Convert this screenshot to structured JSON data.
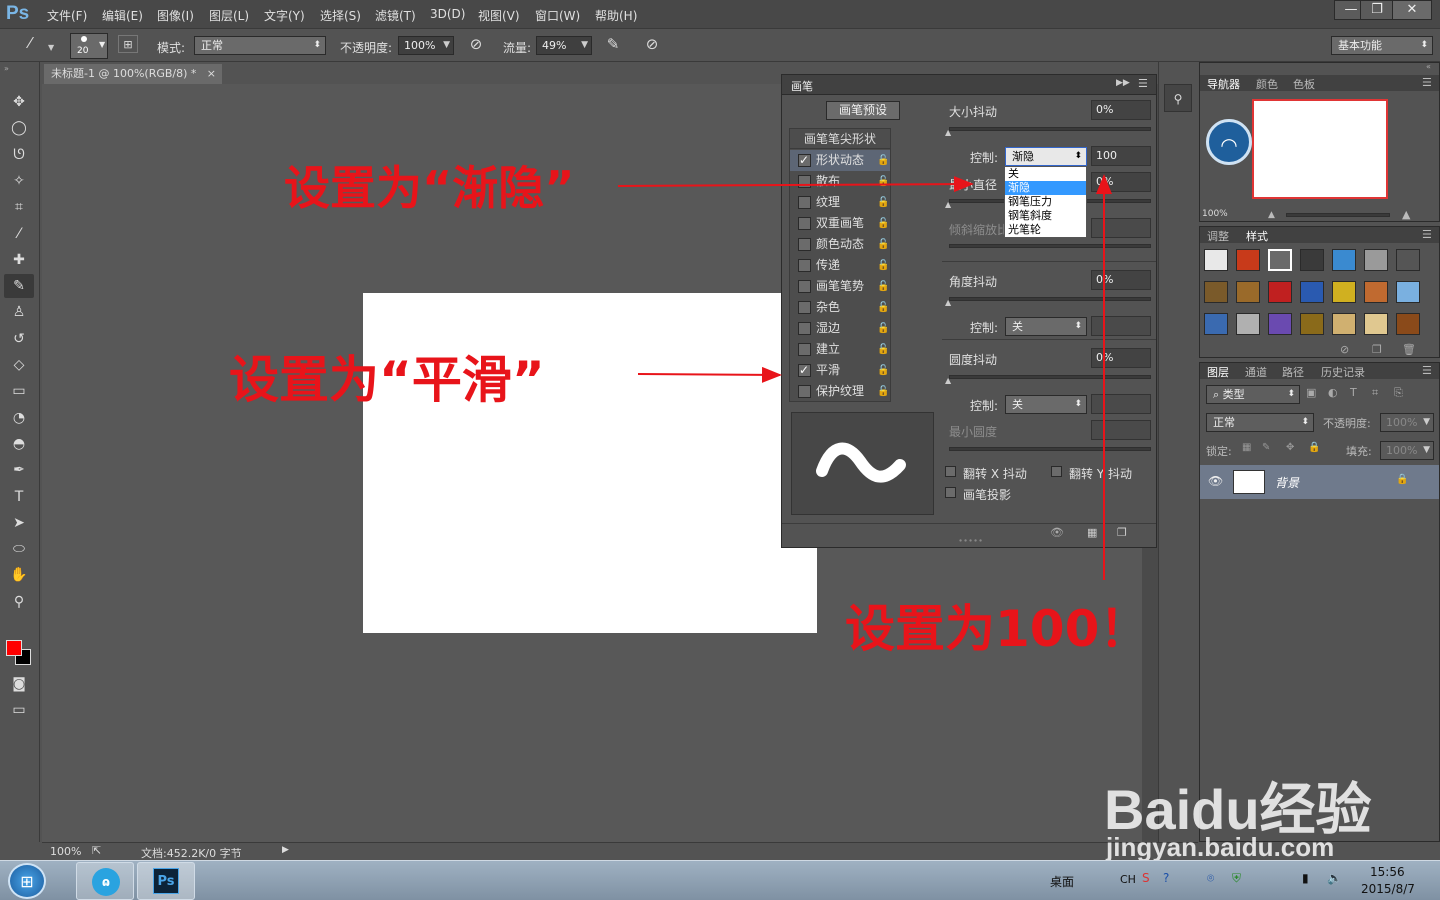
{
  "app": {
    "logo": "Ps"
  },
  "menu": [
    "文件(F)",
    "编辑(E)",
    "图像(I)",
    "图层(L)",
    "文字(Y)",
    "选择(S)",
    "滤镜(T)",
    "3D(D)",
    "视图(V)",
    "窗口(W)",
    "帮助(H)"
  ],
  "window_buttons": [
    "—",
    "❐",
    "✕"
  ],
  "options": {
    "brush_size": "20",
    "mode_label": "模式:",
    "mode_value": "正常",
    "opacity_label": "不透明度:",
    "opacity_value": "100%",
    "flow_label": "流量:",
    "flow_value": "49%",
    "workspace": "基本功能"
  },
  "document": {
    "tab_title": "未标题-1 @ 100%(RGB/8) *",
    "tab_close": "×",
    "zoom": "100%",
    "doc_info": "文档:452.2K/0 字节"
  },
  "colors": {
    "foreground": "#ff0000",
    "background": "#000000",
    "annotation": "#e8141a"
  },
  "tools": [
    "move-icon",
    "marquee-icon",
    "lasso-icon",
    "magic-wand-icon",
    "crop-icon",
    "eyedropper-icon",
    "healing-icon",
    "brush-icon",
    "stamp-icon",
    "history-brush-icon",
    "eraser-icon",
    "gradient-icon",
    "blur-icon",
    "dodge-icon",
    "pen-icon",
    "type-icon",
    "path-select-icon",
    "shape-icon",
    "hand-icon",
    "zoom-icon"
  ],
  "brush_panel": {
    "title": "画笔",
    "preset_button": "画笔预设",
    "tip_shape_label": "画笔笔尖形状",
    "items": [
      {
        "label": "形状动态",
        "checked": true
      },
      {
        "label": "散布",
        "checked": false
      },
      {
        "label": "纹理",
        "checked": false
      },
      {
        "label": "双重画笔",
        "checked": false
      },
      {
        "label": "颜色动态",
        "checked": false
      },
      {
        "label": "传递",
        "checked": false
      },
      {
        "label": "画笔笔势",
        "checked": false
      },
      {
        "label": "杂色",
        "checked": false
      },
      {
        "label": "湿边",
        "checked": false
      },
      {
        "label": "建立",
        "checked": false
      },
      {
        "label": "平滑",
        "checked": true
      },
      {
        "label": "保护纹理",
        "checked": false
      }
    ],
    "size_jitter_label": "大小抖动",
    "size_jitter_value": "0%",
    "control_label": "控制:",
    "control_value": "渐隐",
    "fade_steps": "100",
    "min_diameter_label": "最小直径",
    "min_diameter_value": "0%",
    "tilt_scale_label": "倾斜缩放比例",
    "angle_jitter_label": "角度抖动",
    "angle_jitter_value": "0%",
    "angle_control_value": "关",
    "roundness_jitter_label": "圆度抖动",
    "roundness_jitter_value": "0%",
    "roundness_control_value": "关",
    "min_roundness_label": "最小圆度",
    "flip_x_label": "翻转 X 抖动",
    "flip_y_label": "翻转 Y 抖动",
    "projection_label": "画笔投影",
    "dropdown_options": [
      "关",
      "渐隐",
      "钢笔压力",
      "钢笔斜度",
      "光笔轮"
    ],
    "dropdown_selected": "渐隐"
  },
  "annotations": {
    "fade": "设置为“渐隐”",
    "smooth": "设置为“平滑”",
    "hundred": "设置为100！"
  },
  "right_panels": {
    "navigator_tabs": [
      "导航器",
      "颜色",
      "色板"
    ],
    "nav_zoom": "100%",
    "adjust_tabs": [
      "调整",
      "样式"
    ],
    "layers_tabs": [
      "图层",
      "通道",
      "路径",
      "历史记录"
    ],
    "layer_kind": "类型",
    "blend_mode": "正常",
    "opacity_label": "不透明度:",
    "opacity_value": "100%",
    "lock_label": "锁定:",
    "fill_label": "填充:",
    "fill_value": "100%",
    "layer_name": "背景"
  },
  "watermark": {
    "brand": "Baidu经验",
    "url": "jingyan.baidu.com"
  },
  "taskbar": {
    "desktop_label": "桌面",
    "ime": "CH",
    "time": "15:56",
    "date": "2015/8/7"
  }
}
